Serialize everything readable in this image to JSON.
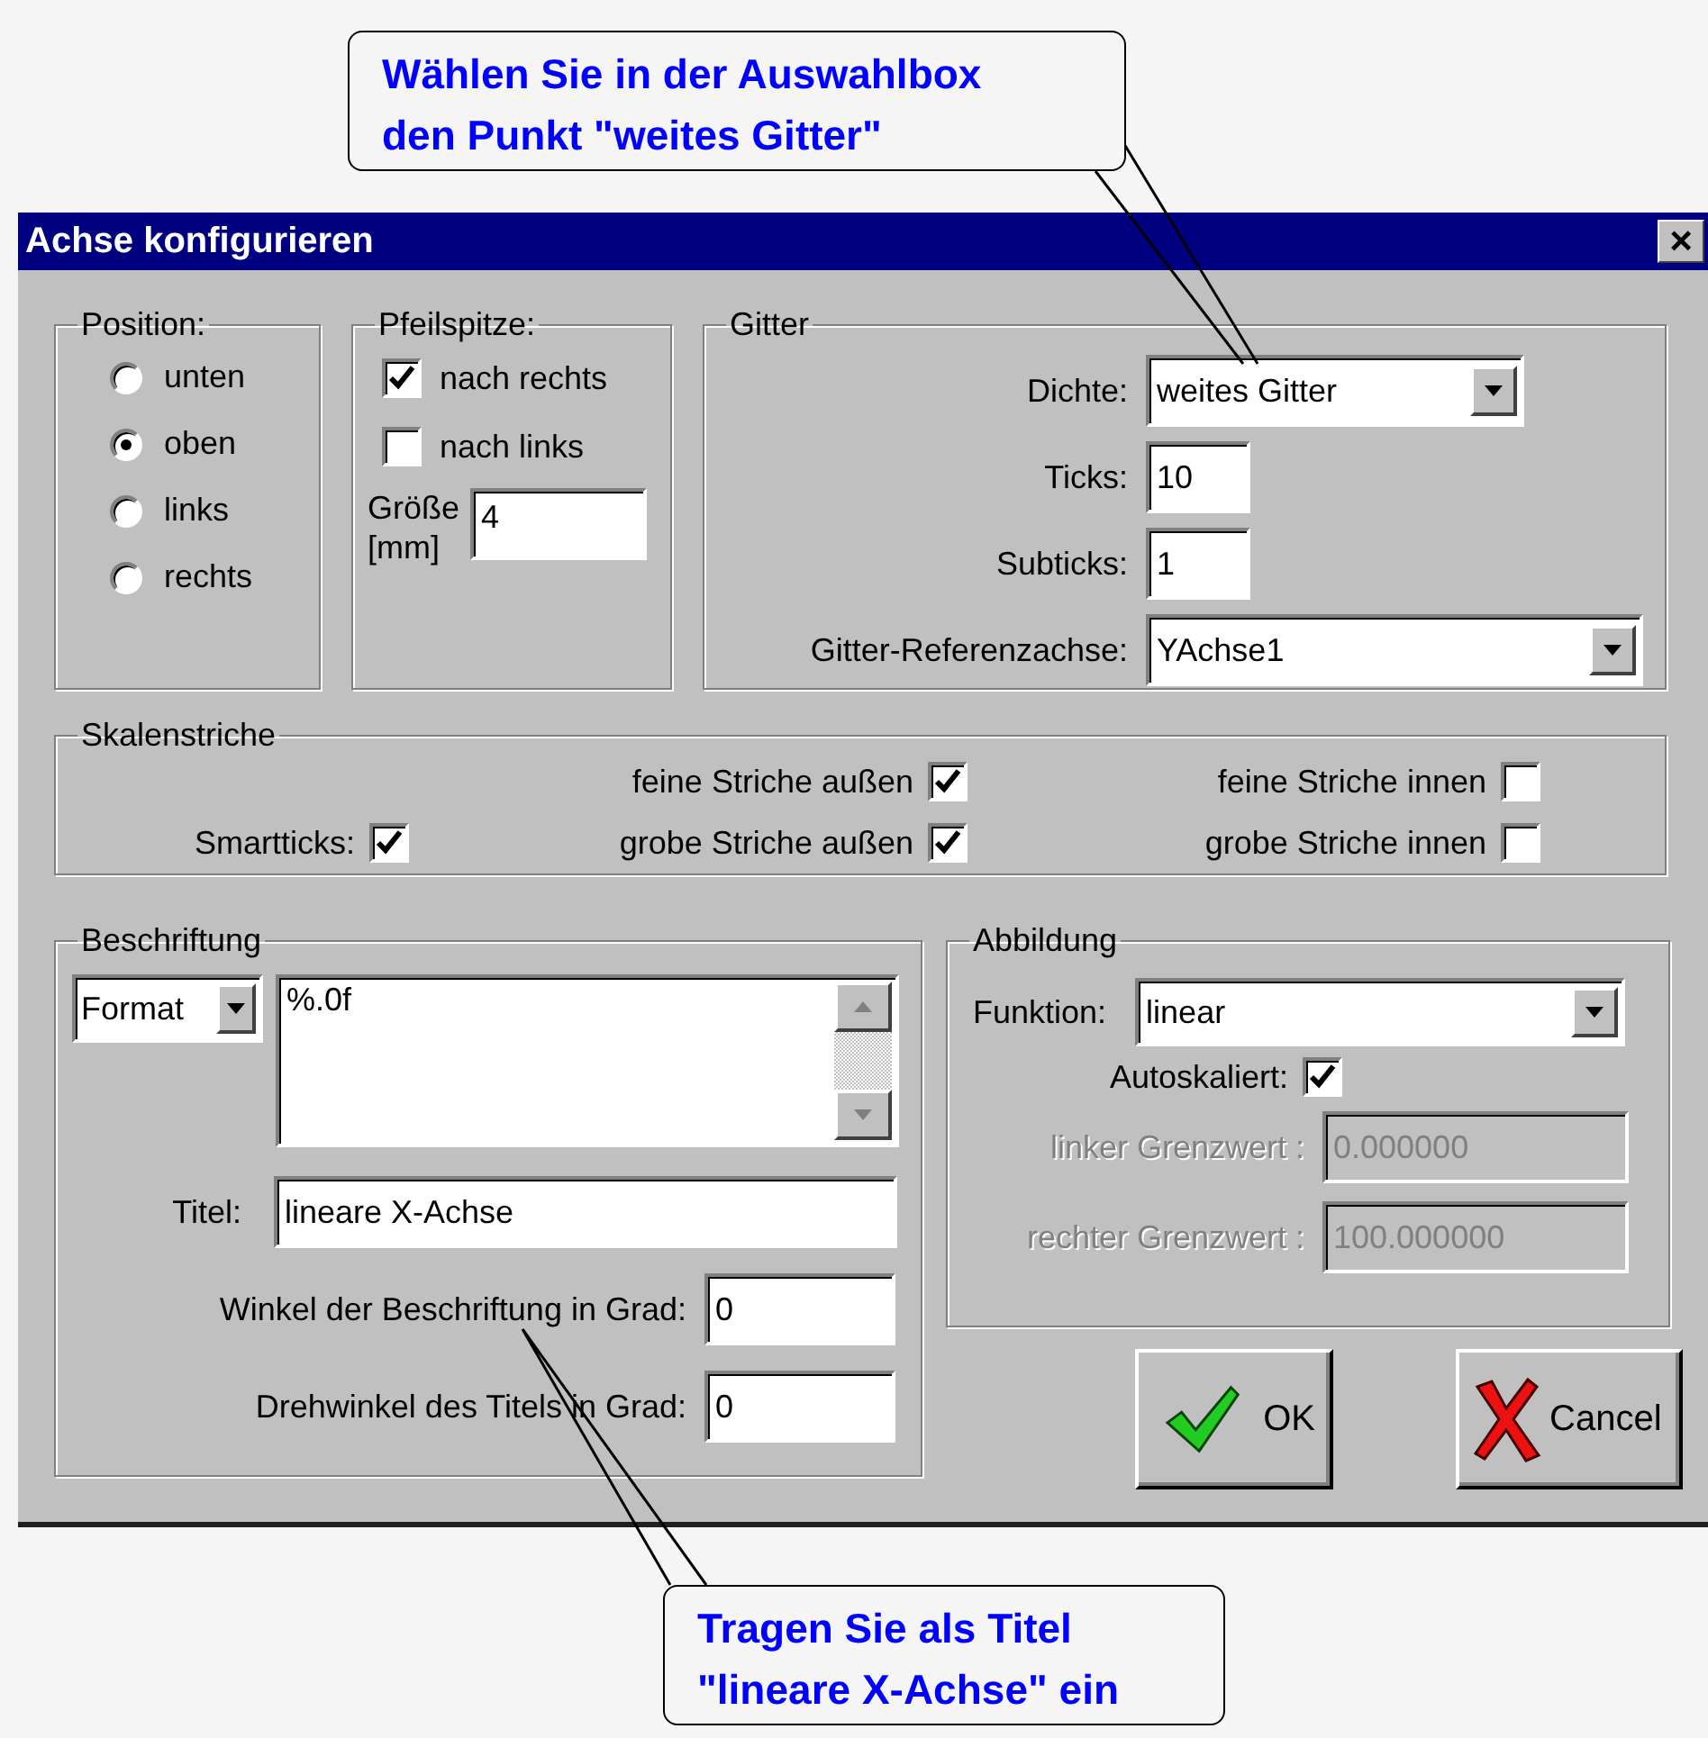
{
  "callouts": [
    {
      "lines": [
        "Wählen Sie in der Auswahlbox",
        "den Punkt \"weites Gitter\""
      ]
    },
    {
      "lines": [
        "Tragen Sie als Titel",
        "\"lineare X-Achse\" ein"
      ]
    }
  ],
  "window": {
    "title": "Achse konfigurieren",
    "close": "×"
  },
  "position": {
    "legend": "Position:",
    "options": [
      {
        "label": "unten",
        "selected": false
      },
      {
        "label": "oben",
        "selected": true
      },
      {
        "label": "links",
        "selected": false
      },
      {
        "label": "rechts",
        "selected": false
      }
    ]
  },
  "pfeilspitze": {
    "legend": "Pfeilspitze:",
    "options": [
      {
        "label": "nach rechts",
        "checked": true
      },
      {
        "label": "nach links",
        "checked": false
      }
    ],
    "size_label": [
      "Größe",
      "[mm]"
    ],
    "size_value": "4"
  },
  "gitter": {
    "legend": "Gitter",
    "fields": [
      {
        "kind": "dropdown",
        "label": "Dichte:",
        "value": "weites Gitter"
      },
      {
        "kind": "input",
        "label": "Ticks:",
        "value": "10"
      },
      {
        "kind": "input",
        "label": "Subticks:",
        "value": "1"
      },
      {
        "kind": "wide_dropdown",
        "label": "Gitter-Referenzachse:",
        "value": "YAchse1"
      }
    ]
  },
  "skalenstriche": {
    "legend": "Skalenstriche",
    "smartticks": {
      "label": "Smartticks:",
      "checked": true
    },
    "options": [
      {
        "label": "feine Striche außen",
        "checked": true
      },
      {
        "label": "feine Striche innen",
        "checked": false
      },
      {
        "label": "grobe Striche außen",
        "checked": true
      },
      {
        "label": "grobe Striche innen",
        "checked": false
      }
    ]
  },
  "beschriftung": {
    "legend": "Beschriftung",
    "format": "Format",
    "format_text": "%.0f",
    "fields": [
      {
        "kind": "wide",
        "label": "Titel:",
        "value": "lineare X-Achse"
      },
      {
        "kind": "short",
        "label": "Winkel der Beschriftung in Grad:",
        "value": "0"
      },
      {
        "kind": "short",
        "label": "Drehwinkel des Titels in Grad:",
        "value": "0"
      }
    ]
  },
  "abbildung": {
    "legend": "Abbildung",
    "function_label": "Funktion:",
    "function_value": "linear",
    "autoscale": {
      "label": "Autoskaliert:",
      "checked": true
    },
    "fields": [
      {
        "label": "linker Grenzwert :",
        "value": "0.000000",
        "disabled": true
      },
      {
        "label": "rechter Grenzwert :",
        "value": "100.000000",
        "disabled": true
      }
    ]
  },
  "buttons": [
    {
      "kind": "ok",
      "label": "OK"
    },
    {
      "kind": "cancel",
      "label": "Cancel"
    }
  ]
}
